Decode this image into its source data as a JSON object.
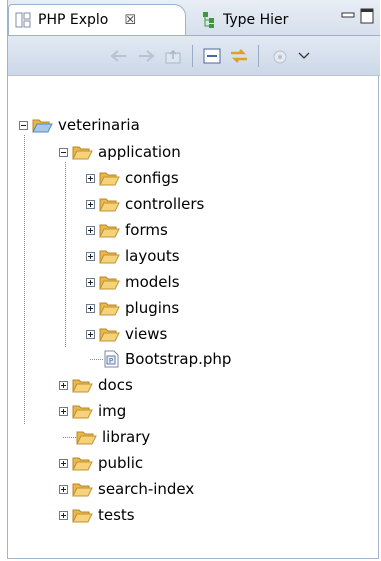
{
  "tabs": [
    {
      "title": "PHP Explo",
      "close": "☒",
      "active": true
    },
    {
      "title": "Type Hier",
      "active": false
    }
  ],
  "tree": {
    "root": {
      "label": "veterinaria"
    },
    "application": {
      "label": "application",
      "children": [
        "configs",
        "controllers",
        "forms",
        "layouts",
        "models",
        "plugins",
        "views"
      ],
      "file": "Bootstrap.php"
    },
    "siblings": [
      {
        "label": "docs"
      },
      {
        "label": "img"
      },
      {
        "label": "library"
      },
      {
        "label": "public"
      },
      {
        "label": "search-index"
      },
      {
        "label": "tests"
      }
    ]
  },
  "colors": {
    "accent": "#9fb2cc",
    "folder": "#f3c85a"
  }
}
